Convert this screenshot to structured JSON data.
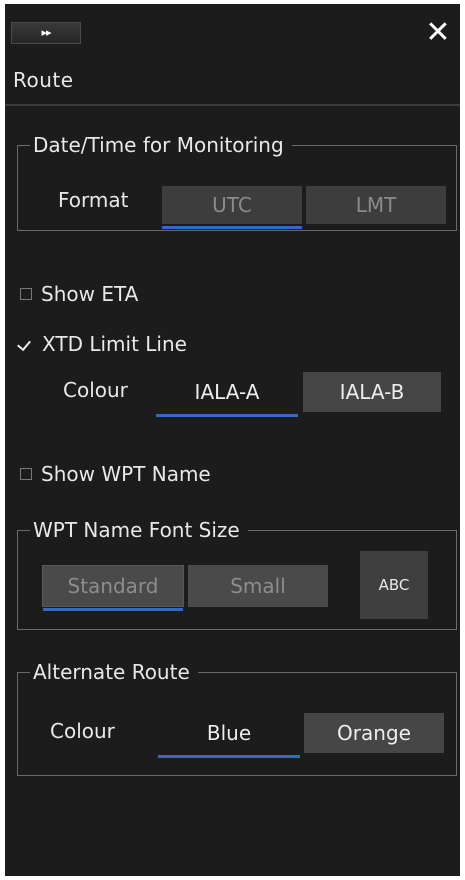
{
  "header": {
    "collapse_icon": "double-chevron-right",
    "collapse_glyph": "▸▸",
    "close_icon": "close-x",
    "close_glyph": "✕",
    "title": "Route"
  },
  "monitoring": {
    "legend": "Date/Time for Monitoring",
    "format_label": "Format",
    "options": [
      "UTC",
      "LMT"
    ],
    "selected": "UTC"
  },
  "show_eta": {
    "label": "Show ETA",
    "checked": false
  },
  "xtd": {
    "label": "XTD Limit Line",
    "checked": true,
    "colour_label": "Colour",
    "options": [
      "IALA-A",
      "IALA-B"
    ],
    "selected": "IALA-A"
  },
  "show_wpt_name": {
    "label": "Show WPT Name",
    "checked": false
  },
  "wpt_font": {
    "legend": "WPT Name Font Size",
    "options": [
      "Standard",
      "Small"
    ],
    "selected": "Standard",
    "preview": "ABC"
  },
  "alternate": {
    "legend": "Alternate Route",
    "colour_label": "Colour",
    "options": [
      "Blue",
      "Orange"
    ],
    "selected": "Blue"
  },
  "colors": {
    "panel_bg": "#1c1c1c",
    "selected_underline": "#2f6bc9",
    "button_bg": "#3d3d3d",
    "text": "#e8e8e8"
  }
}
